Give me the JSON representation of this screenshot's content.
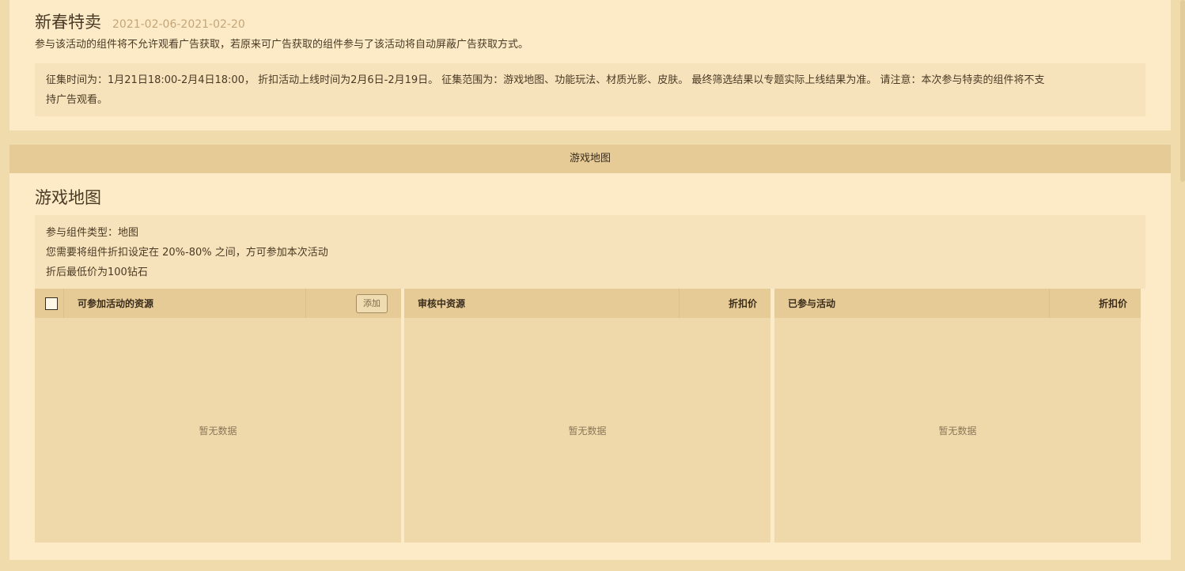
{
  "activity": {
    "title": "新春特卖",
    "date_range": "2021-02-06-2021-02-20",
    "subtitle": "参与该活动的组件将不允许观看广告获取，若原来可广告获取的组件参与了该活动将自动屏蔽广告获取方式。",
    "notice_line1": "征集时间为：1月21日18:00-2月4日18:00， 折扣活动上线时间为2月6日-2月19日。 征集范围为：游戏地图、功能玩法、材质光影、皮肤。 最终筛选结果以专题实际上线结果为准。 请注意：本次参与特卖的组件将不支",
    "notice_line2": "持广告观看。"
  },
  "tabbar": {
    "active_tab": "游戏地图"
  },
  "section": {
    "title": "游戏地图",
    "rules": [
      "参与组件类型：地图",
      "您需要将组件折扣设定在 20%-80% 之间，方可参加本次活动",
      "折后最低价为100钻石"
    ]
  },
  "panels": {
    "available": {
      "header": "可参加活动的资源",
      "add_label": "添加",
      "empty": "暂无数据"
    },
    "reviewing": {
      "header": "审核中资源",
      "price_header": "折扣价",
      "empty": "暂无数据"
    },
    "joined": {
      "header": "已参与活动",
      "price_header": "折扣价",
      "empty": "暂无数据"
    }
  }
}
